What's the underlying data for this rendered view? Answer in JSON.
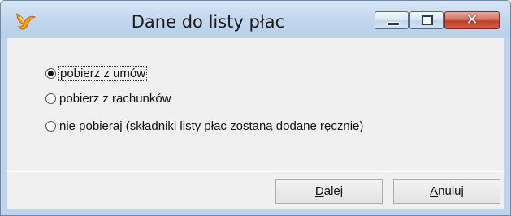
{
  "window": {
    "title": "Dane do listy płac",
    "icon": "app-icon"
  },
  "options": [
    {
      "label": "pobierz z umów",
      "checked": true
    },
    {
      "label": "pobierz z rachunków",
      "checked": false
    },
    {
      "label": "nie pobieraj (składniki listy płac zostaną dodane ręcznie)",
      "checked": false
    }
  ],
  "buttons": {
    "next_mnemonic": "D",
    "next_rest": "alej",
    "cancel_mnemonic": "A",
    "cancel_rest": "nuluj"
  },
  "colors": {
    "titlebar": "#c3d7ee",
    "client": "#f0f0f0",
    "close": "#c0402a"
  }
}
